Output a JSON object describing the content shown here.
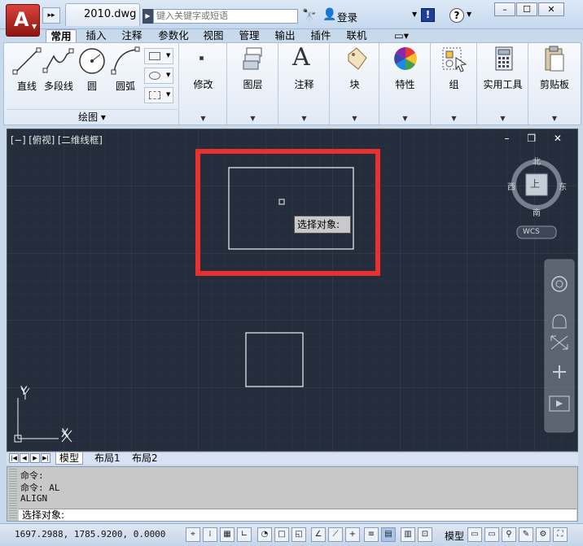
{
  "app": {
    "logo": "A",
    "doc_tab": "2010.dwg"
  },
  "search": {
    "placeholder": "键入关键字或短语"
  },
  "title_right": {
    "login": "登录",
    "info": "!",
    "help": "?"
  },
  "window_buttons": [
    "–",
    "☐",
    "✕"
  ],
  "menu_tabs": [
    "常用",
    "插入",
    "注释",
    "参数化",
    "视图",
    "管理",
    "输出",
    "插件",
    "联机"
  ],
  "extra_tab": "▭▾",
  "ribbon": {
    "draw_tools": [
      "直线",
      "多段线",
      "圆",
      "圆弧"
    ],
    "draw_panel_footer": "绘图 ▾",
    "panels": [
      "修改",
      "图层",
      "注释",
      "块",
      "特性",
      "组",
      "实用工具",
      "剪贴板"
    ]
  },
  "viewport": {
    "label": "[−] [俯视] [二维线框]",
    "controls": "– ❐ ✕",
    "tooltip": "选择对象:",
    "viewcube": {
      "top_face": "上",
      "north": "北",
      "south": "南",
      "east": "东",
      "west": "西",
      "wcs": "WCS"
    },
    "ucs": {
      "x": "X",
      "y": "Y"
    }
  },
  "layout_tabs": [
    "模型",
    "布局1",
    "布局2"
  ],
  "command": {
    "history": [
      "命令:",
      "命令: AL",
      "ALIGN"
    ],
    "prompt": "选择对象:"
  },
  "status": {
    "coords": "1697.2988, 1785.9200, 0.0000",
    "model_button": "模型"
  },
  "colors": {
    "canvas": "#252d3c",
    "highlight": "#e8302e",
    "ribbon": "#e6edf6"
  }
}
